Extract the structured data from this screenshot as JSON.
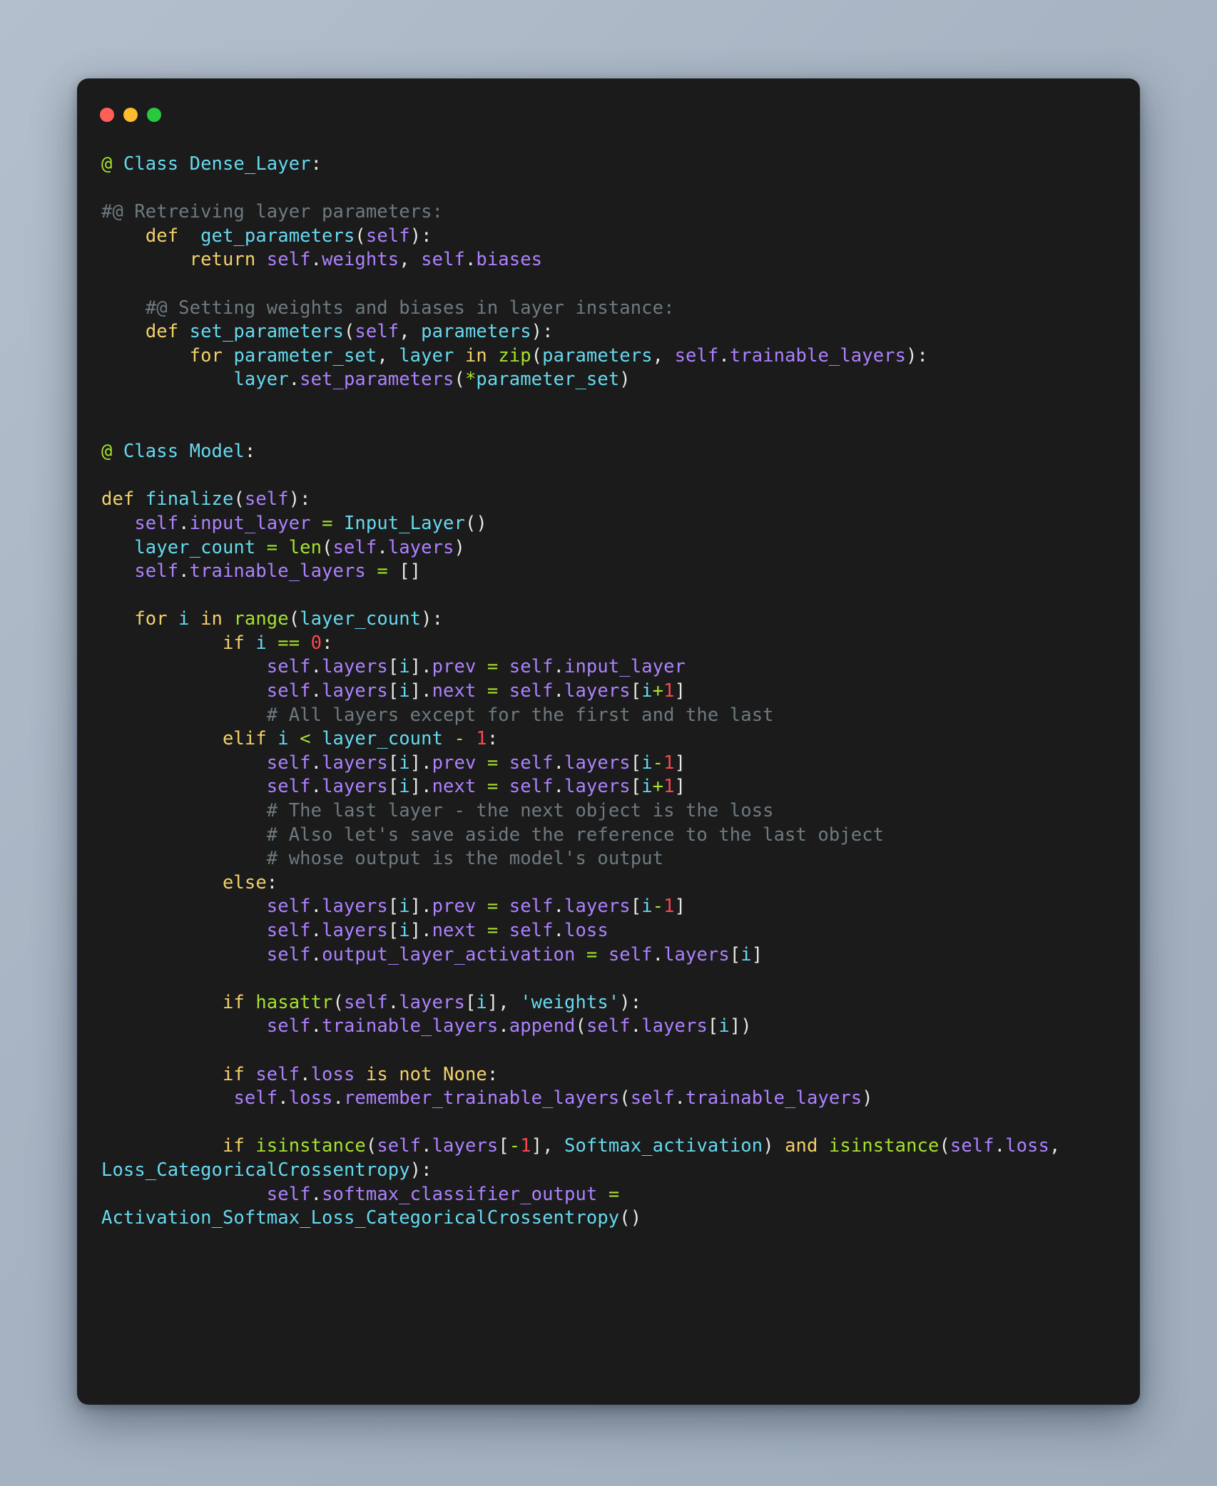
{
  "window": {
    "title_bar": {
      "buttons": [
        {
          "name": "close",
          "color": "#ff5f57"
        },
        {
          "name": "minimize",
          "color": "#febc2e"
        },
        {
          "name": "maximize",
          "color": "#28c840"
        }
      ]
    },
    "background_color": "#1b1b1b",
    "page_background": "#a6b3c2"
  },
  "theme": {
    "comment": "#6e7a80",
    "keyword": "#f3d06a",
    "builtin": "#a6e22e",
    "name": "#66d9ef",
    "self_attr": "#ae81ff",
    "number": "#f9484f",
    "operator": "#a6e22e",
    "punctuation": "#e8e8e3",
    "string": "#66d9ef"
  },
  "code": {
    "language": "python",
    "lines": [
      "@ Class Dense_Layer:",
      "",
      "#@ Retreiving layer parameters:",
      "    def  get_parameters(self):",
      "        return self.weights, self.biases",
      "",
      "    #@ Setting weights and biases in layer instance:",
      "    def set_parameters(self, parameters):",
      "        for parameter_set, layer in zip(parameters, self.trainable_layers):",
      "            layer.set_parameters(*parameter_set)",
      "",
      "",
      "@ Class Model:",
      "",
      "def finalize(self):",
      "   self.input_layer = Input_Layer()",
      "   layer_count = len(self.layers)",
      "   self.trainable_layers = []",
      "",
      "   for i in range(layer_count):",
      "           if i == 0:",
      "               self.layers[i].prev = self.input_layer",
      "               self.layers[i].next = self.layers[i+1]",
      "               # All layers except for the first and the last",
      "           elif i < layer_count - 1:",
      "               self.layers[i].prev = self.layers[i-1]",
      "               self.layers[i].next = self.layers[i+1]",
      "               # The last layer - the next object is the loss",
      "               # Also let's save aside the reference to the last object",
      "               # whose output is the model's output",
      "           else:",
      "               self.layers[i].prev = self.layers[i-1]",
      "               self.layers[i].next = self.loss",
      "               self.output_layer_activation = self.layers[i]",
      "",
      "           if hasattr(self.layers[i], 'weights'):",
      "               self.trainable_layers.append(self.layers[i])",
      "",
      "           if self.loss is not None:",
      "            self.loss.remember_trainable_layers(self.trainable_layers)",
      "",
      "           if isinstance(self.layers[-1], Softmax_activation) and isinstance(self.loss, Loss_CategoricalCrossentropy):",
      "               self.softmax_classifier_output = Activation_Softmax_Loss_CategoricalCrossentropy()"
    ],
    "html": "<span class=\"at\">@</span> <span class=\"n\">Class Dense_Layer</span><span class=\"p\">:</span>\n\n<span class=\"c\">#@ Retreiving layer parameters:</span>\n    <span class=\"k\">def</span>  <span class=\"n\">get_parameters</span><span class=\"p\">(</span><span class=\"s\">self</span><span class=\"p\">):</span>\n        <span class=\"k\">return</span> <span class=\"s\">self</span><span class=\"p\">.</span><span class=\"s\">weights</span><span class=\"p\">,</span> <span class=\"s\">self</span><span class=\"p\">.</span><span class=\"s\">biases</span>\n\n    <span class=\"c\">#@ Setting weights and biases in layer instance:</span>\n    <span class=\"k\">def</span> <span class=\"n\">set_parameters</span><span class=\"p\">(</span><span class=\"s\">self</span><span class=\"p\">,</span> <span class=\"n\">parameters</span><span class=\"p\">):</span>\n        <span class=\"k\">for</span> <span class=\"n\">parameter_set</span><span class=\"p\">,</span> <span class=\"n\">layer</span> <span class=\"k\">in</span> <span class=\"b\">zip</span><span class=\"p\">(</span><span class=\"n\">parameters</span><span class=\"p\">,</span> <span class=\"s\">self</span><span class=\"p\">.</span><span class=\"s\">trainable_layers</span><span class=\"p\">):</span>\n            <span class=\"n\">layer</span><span class=\"p\">.</span><span class=\"s\">set_parameters</span><span class=\"p\">(</span><span class=\"o\">*</span><span class=\"n\">parameter_set</span><span class=\"p\">)</span>\n\n\n<span class=\"at\">@</span> <span class=\"n\">Class Model</span><span class=\"p\">:</span>\n\n<span class=\"k\">def</span> <span class=\"n\">finalize</span><span class=\"p\">(</span><span class=\"s\">self</span><span class=\"p\">):</span>\n   <span class=\"s\">self</span><span class=\"p\">.</span><span class=\"s\">input_layer</span> <span class=\"o\">=</span> <span class=\"n\">Input_Layer</span><span class=\"p\">()</span>\n   <span class=\"n\">layer_count</span> <span class=\"o\">=</span> <span class=\"b\">len</span><span class=\"p\">(</span><span class=\"s\">self</span><span class=\"p\">.</span><span class=\"s\">layers</span><span class=\"p\">)</span>\n   <span class=\"s\">self</span><span class=\"p\">.</span><span class=\"s\">trainable_layers</span> <span class=\"o\">=</span> <span class=\"p\">[]</span>\n\n   <span class=\"k\">for</span> <span class=\"n\">i</span> <span class=\"k\">in</span> <span class=\"b\">range</span><span class=\"p\">(</span><span class=\"n\">layer_count</span><span class=\"p\">):</span>\n           <span class=\"k\">if</span> <span class=\"n\">i</span> <span class=\"o\">==</span> <span class=\"num\">0</span><span class=\"p\">:</span>\n               <span class=\"s\">self</span><span class=\"p\">.</span><span class=\"s\">layers</span><span class=\"p\">[</span><span class=\"n\">i</span><span class=\"p\">].</span><span class=\"s\">prev</span> <span class=\"o\">=</span> <span class=\"s\">self</span><span class=\"p\">.</span><span class=\"s\">input_layer</span>\n               <span class=\"s\">self</span><span class=\"p\">.</span><span class=\"s\">layers</span><span class=\"p\">[</span><span class=\"n\">i</span><span class=\"p\">].</span><span class=\"s\">next</span> <span class=\"o\">=</span> <span class=\"s\">self</span><span class=\"p\">.</span><span class=\"s\">layers</span><span class=\"p\">[</span><span class=\"n\">i</span><span class=\"o\">+</span><span class=\"num\">1</span><span class=\"p\">]</span>\n               <span class=\"c\"># All layers except for the first and the last</span>\n           <span class=\"k\">elif</span> <span class=\"n\">i</span> <span class=\"o\">&lt;</span> <span class=\"n\">layer_count</span> <span class=\"o\">-</span> <span class=\"num\">1</span><span class=\"p\">:</span>\n               <span class=\"s\">self</span><span class=\"p\">.</span><span class=\"s\">layers</span><span class=\"p\">[</span><span class=\"n\">i</span><span class=\"p\">].</span><span class=\"s\">prev</span> <span class=\"o\">=</span> <span class=\"s\">self</span><span class=\"p\">.</span><span class=\"s\">layers</span><span class=\"p\">[</span><span class=\"n\">i</span><span class=\"o\">-</span><span class=\"num\">1</span><span class=\"p\">]</span>\n               <span class=\"s\">self</span><span class=\"p\">.</span><span class=\"s\">layers</span><span class=\"p\">[</span><span class=\"n\">i</span><span class=\"p\">].</span><span class=\"s\">next</span> <span class=\"o\">=</span> <span class=\"s\">self</span><span class=\"p\">.</span><span class=\"s\">layers</span><span class=\"p\">[</span><span class=\"n\">i</span><span class=\"o\">+</span><span class=\"num\">1</span><span class=\"p\">]</span>\n               <span class=\"c\"># The last layer - the next object is the loss</span>\n               <span class=\"c\"># Also let's save aside the reference to the last object</span>\n               <span class=\"c\"># whose output is the model's output</span>\n           <span class=\"k\">else</span><span class=\"p\">:</span>\n               <span class=\"s\">self</span><span class=\"p\">.</span><span class=\"s\">layers</span><span class=\"p\">[</span><span class=\"n\">i</span><span class=\"p\">].</span><span class=\"s\">prev</span> <span class=\"o\">=</span> <span class=\"s\">self</span><span class=\"p\">.</span><span class=\"s\">layers</span><span class=\"p\">[</span><span class=\"n\">i</span><span class=\"o\">-</span><span class=\"num\">1</span><span class=\"p\">]</span>\n               <span class=\"s\">self</span><span class=\"p\">.</span><span class=\"s\">layers</span><span class=\"p\">[</span><span class=\"n\">i</span><span class=\"p\">].</span><span class=\"s\">next</span> <span class=\"o\">=</span> <span class=\"s\">self</span><span class=\"p\">.</span><span class=\"s\">loss</span>\n               <span class=\"s\">self</span><span class=\"p\">.</span><span class=\"s\">output_layer_activation</span> <span class=\"o\">=</span> <span class=\"s\">self</span><span class=\"p\">.</span><span class=\"s\">layers</span><span class=\"p\">[</span><span class=\"n\">i</span><span class=\"p\">]</span>\n\n           <span class=\"k\">if</span> <span class=\"b\">hasattr</span><span class=\"p\">(</span><span class=\"s\">self</span><span class=\"p\">.</span><span class=\"s\">layers</span><span class=\"p\">[</span><span class=\"n\">i</span><span class=\"p\">],</span> <span class=\"str\">'weights'</span><span class=\"p\">):</span>\n               <span class=\"s\">self</span><span class=\"p\">.</span><span class=\"s\">trainable_layers</span><span class=\"p\">.</span><span class=\"s\">append</span><span class=\"p\">(</span><span class=\"s\">self</span><span class=\"p\">.</span><span class=\"s\">layers</span><span class=\"p\">[</span><span class=\"n\">i</span><span class=\"p\">])</span>\n\n           <span class=\"k\">if</span> <span class=\"s\">self</span><span class=\"p\">.</span><span class=\"s\">loss</span> <span class=\"k\">is</span> <span class=\"k\">not</span> <span class=\"k\">None</span><span class=\"p\">:</span>\n            <span class=\"s\">self</span><span class=\"p\">.</span><span class=\"s\">loss</span><span class=\"p\">.</span><span class=\"s\">remember_trainable_layers</span><span class=\"p\">(</span><span class=\"s\">self</span><span class=\"p\">.</span><span class=\"s\">trainable_layers</span><span class=\"p\">)</span>\n\n           <span class=\"k\">if</span> <span class=\"b\">isinstance</span><span class=\"p\">(</span><span class=\"s\">self</span><span class=\"p\">.</span><span class=\"s\">layers</span><span class=\"p\">[</span><span class=\"o\">-</span><span class=\"num\">1</span><span class=\"p\">],</span> <span class=\"n\">Softmax_activation</span><span class=\"p\">)</span> <span class=\"k\">and</span> <span class=\"b\">isinstance</span><span class=\"p\">(</span><span class=\"s\">self</span><span class=\"p\">.</span><span class=\"s\">loss</span><span class=\"p\">,</span> <span class=\"n\">Loss_CategoricalCrossentropy</span><span class=\"p\">):</span>\n               <span class=\"s\">self</span><span class=\"p\">.</span><span class=\"s\">softmax_classifier_output</span> <span class=\"o\">=</span> <span class=\"n\">Activation_Softmax_Loss_CategoricalCrossentropy</span><span class=\"p\">()</span>"
  }
}
